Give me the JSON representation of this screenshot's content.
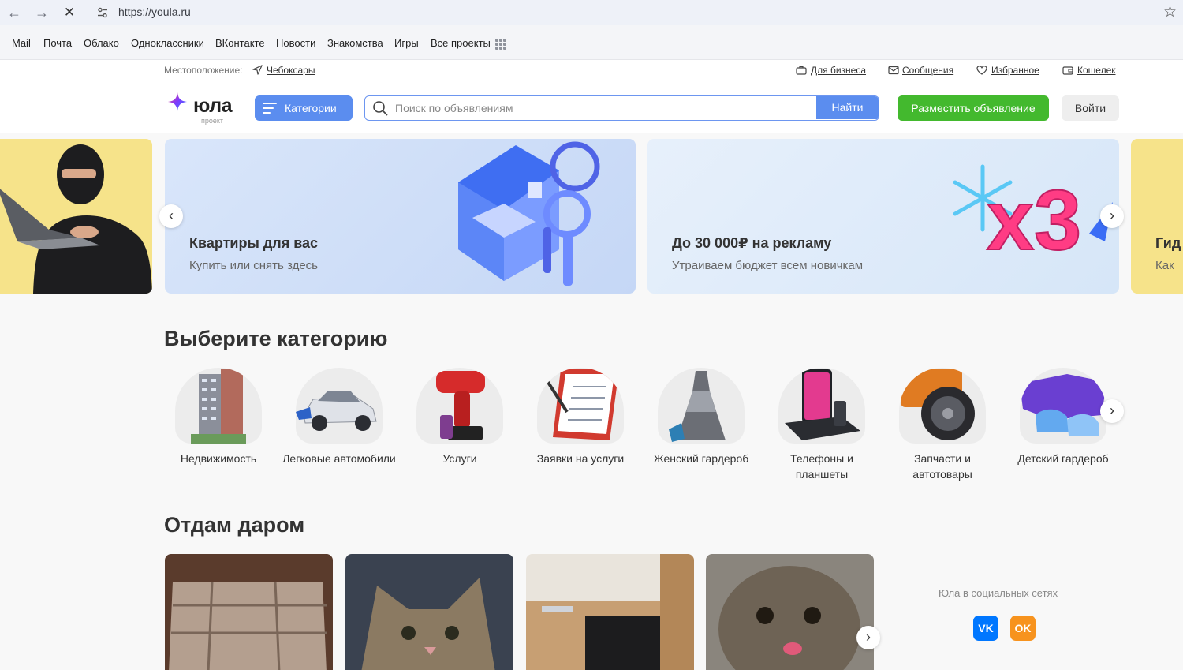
{
  "browser": {
    "url": "https://youla.ru"
  },
  "bookmarks": [
    "Mail",
    "Почта",
    "Облако",
    "Одноклассники",
    "ВКонтакте",
    "Новости",
    "Знакомства",
    "Игры",
    "Все проекты"
  ],
  "header": {
    "location_label": "Местоположение:",
    "location_city": "Чебоксары",
    "links": {
      "business": "Для бизнеса",
      "messages": "Сообщения",
      "favorites": "Избранное",
      "wallet": "Кошелек"
    },
    "logo_text": "юла",
    "logo_sub": "проект",
    "categories_button": "Категории",
    "search_placeholder": "Поиск по объявлениям",
    "search_button": "Найти",
    "post_button": "Разместить объявление",
    "login_button": "Войти"
  },
  "banners": [
    {
      "title": "Квартиры для вас",
      "subtitle": "Купить или снять здесь"
    },
    {
      "title": "До 30 000₽ на рекламу",
      "subtitle": "Утраиваем бюджет всем новичкам"
    },
    {
      "title": "Гид",
      "subtitle": "Как"
    }
  ],
  "banner_art": {
    "multiplier": "x3"
  },
  "categories": {
    "title": "Выберите категорию",
    "items": [
      {
        "label": "Недвижимость",
        "icon": "building-icon"
      },
      {
        "label": "Легковые автомобили",
        "icon": "car-icon"
      },
      {
        "label": "Услуги",
        "icon": "drill-icon"
      },
      {
        "label": "Заявки на услуги",
        "icon": "clipboard-icon"
      },
      {
        "label": "Женский гардероб",
        "icon": "dress-icon"
      },
      {
        "label": "Телефоны и планшеты",
        "icon": "phone-icon"
      },
      {
        "label": "Запчасти и автотовары",
        "icon": "wheel-icon"
      },
      {
        "label": "Детский гардероб",
        "icon": "kids-clothes-icon"
      }
    ]
  },
  "free": {
    "title": "Отдам даром",
    "cards": [
      "sofa-photo",
      "kitten-photo",
      "furniture-photo",
      "kitten-photo"
    ]
  },
  "social": {
    "label": "Юла в социальных сетях",
    "vk": "VK",
    "ok": "OK"
  },
  "colors": {
    "accent_blue": "#5b8def",
    "green": "#43b92e",
    "banner_yellow": "#f6e38a"
  }
}
